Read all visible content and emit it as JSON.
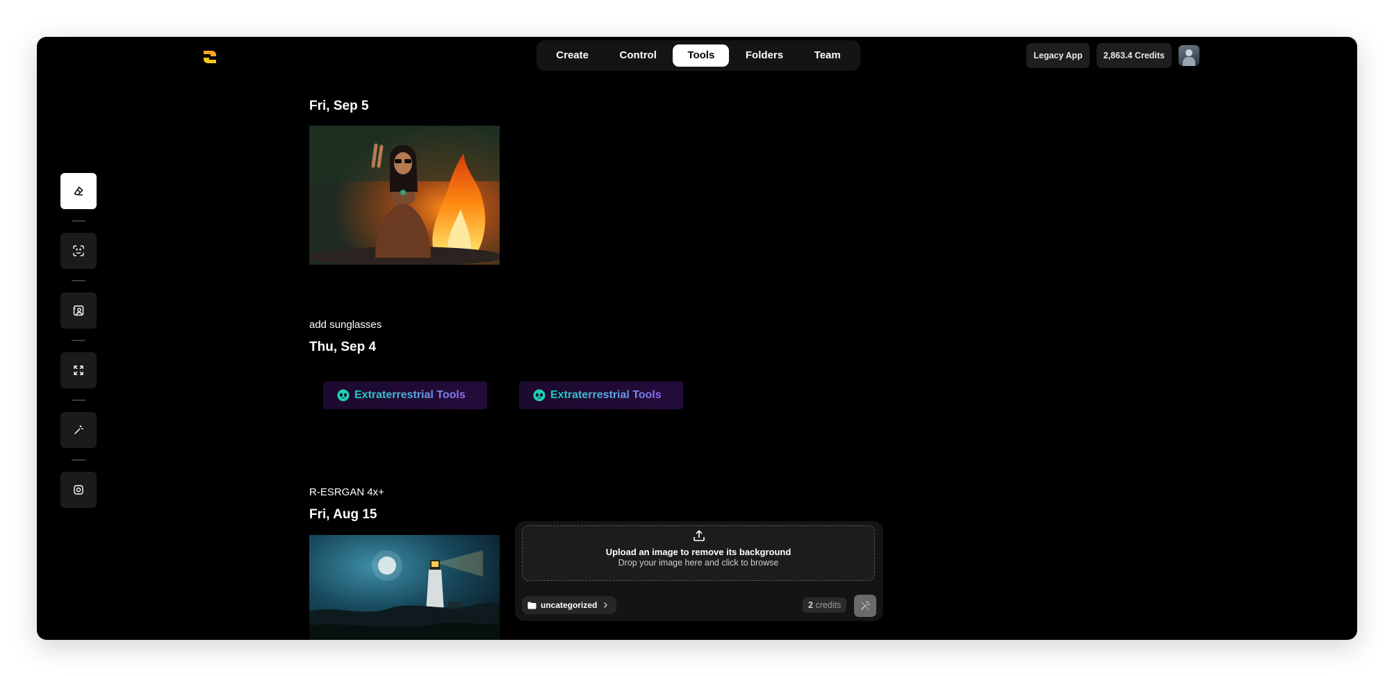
{
  "nav": {
    "tabs": [
      {
        "label": "Create",
        "active": false
      },
      {
        "label": "Control",
        "active": false
      },
      {
        "label": "Tools",
        "active": true
      },
      {
        "label": "Folders",
        "active": false
      },
      {
        "label": "Team",
        "active": false
      }
    ]
  },
  "header": {
    "legacy_label": "Legacy App",
    "credits_label": "2,863.4 Credits"
  },
  "sidebar": {
    "tools": [
      {
        "icon": "eraser-icon",
        "active": true
      },
      {
        "icon": "scan-face-icon",
        "active": false
      },
      {
        "icon": "image-person-icon",
        "active": false
      },
      {
        "icon": "expand-icon",
        "active": false
      },
      {
        "icon": "magic-wand-icon",
        "active": false
      },
      {
        "icon": "camera-frame-icon",
        "active": false
      }
    ]
  },
  "feed": {
    "groups": [
      {
        "date": "Fri, Sep 5",
        "caption": "add sunglasses"
      },
      {
        "date": "Thu, Sep 4",
        "caption": "R-ESRGAN 4x+",
        "cards": [
          "Extraterrestrial Tools",
          "Extraterrestrial Tools"
        ]
      },
      {
        "date": "Fri, Aug 15"
      }
    ]
  },
  "upload": {
    "title": "Upload an image to remove its background",
    "subtitle": "Drop your image here and click to browse",
    "folder": "uncategorized",
    "credits_value": "2",
    "credits_unit": "credits"
  },
  "colors": {
    "background": "#000000",
    "accent": "#ffffff",
    "gradient_start": "#16d1c3",
    "gradient_end": "#8f6df3"
  }
}
